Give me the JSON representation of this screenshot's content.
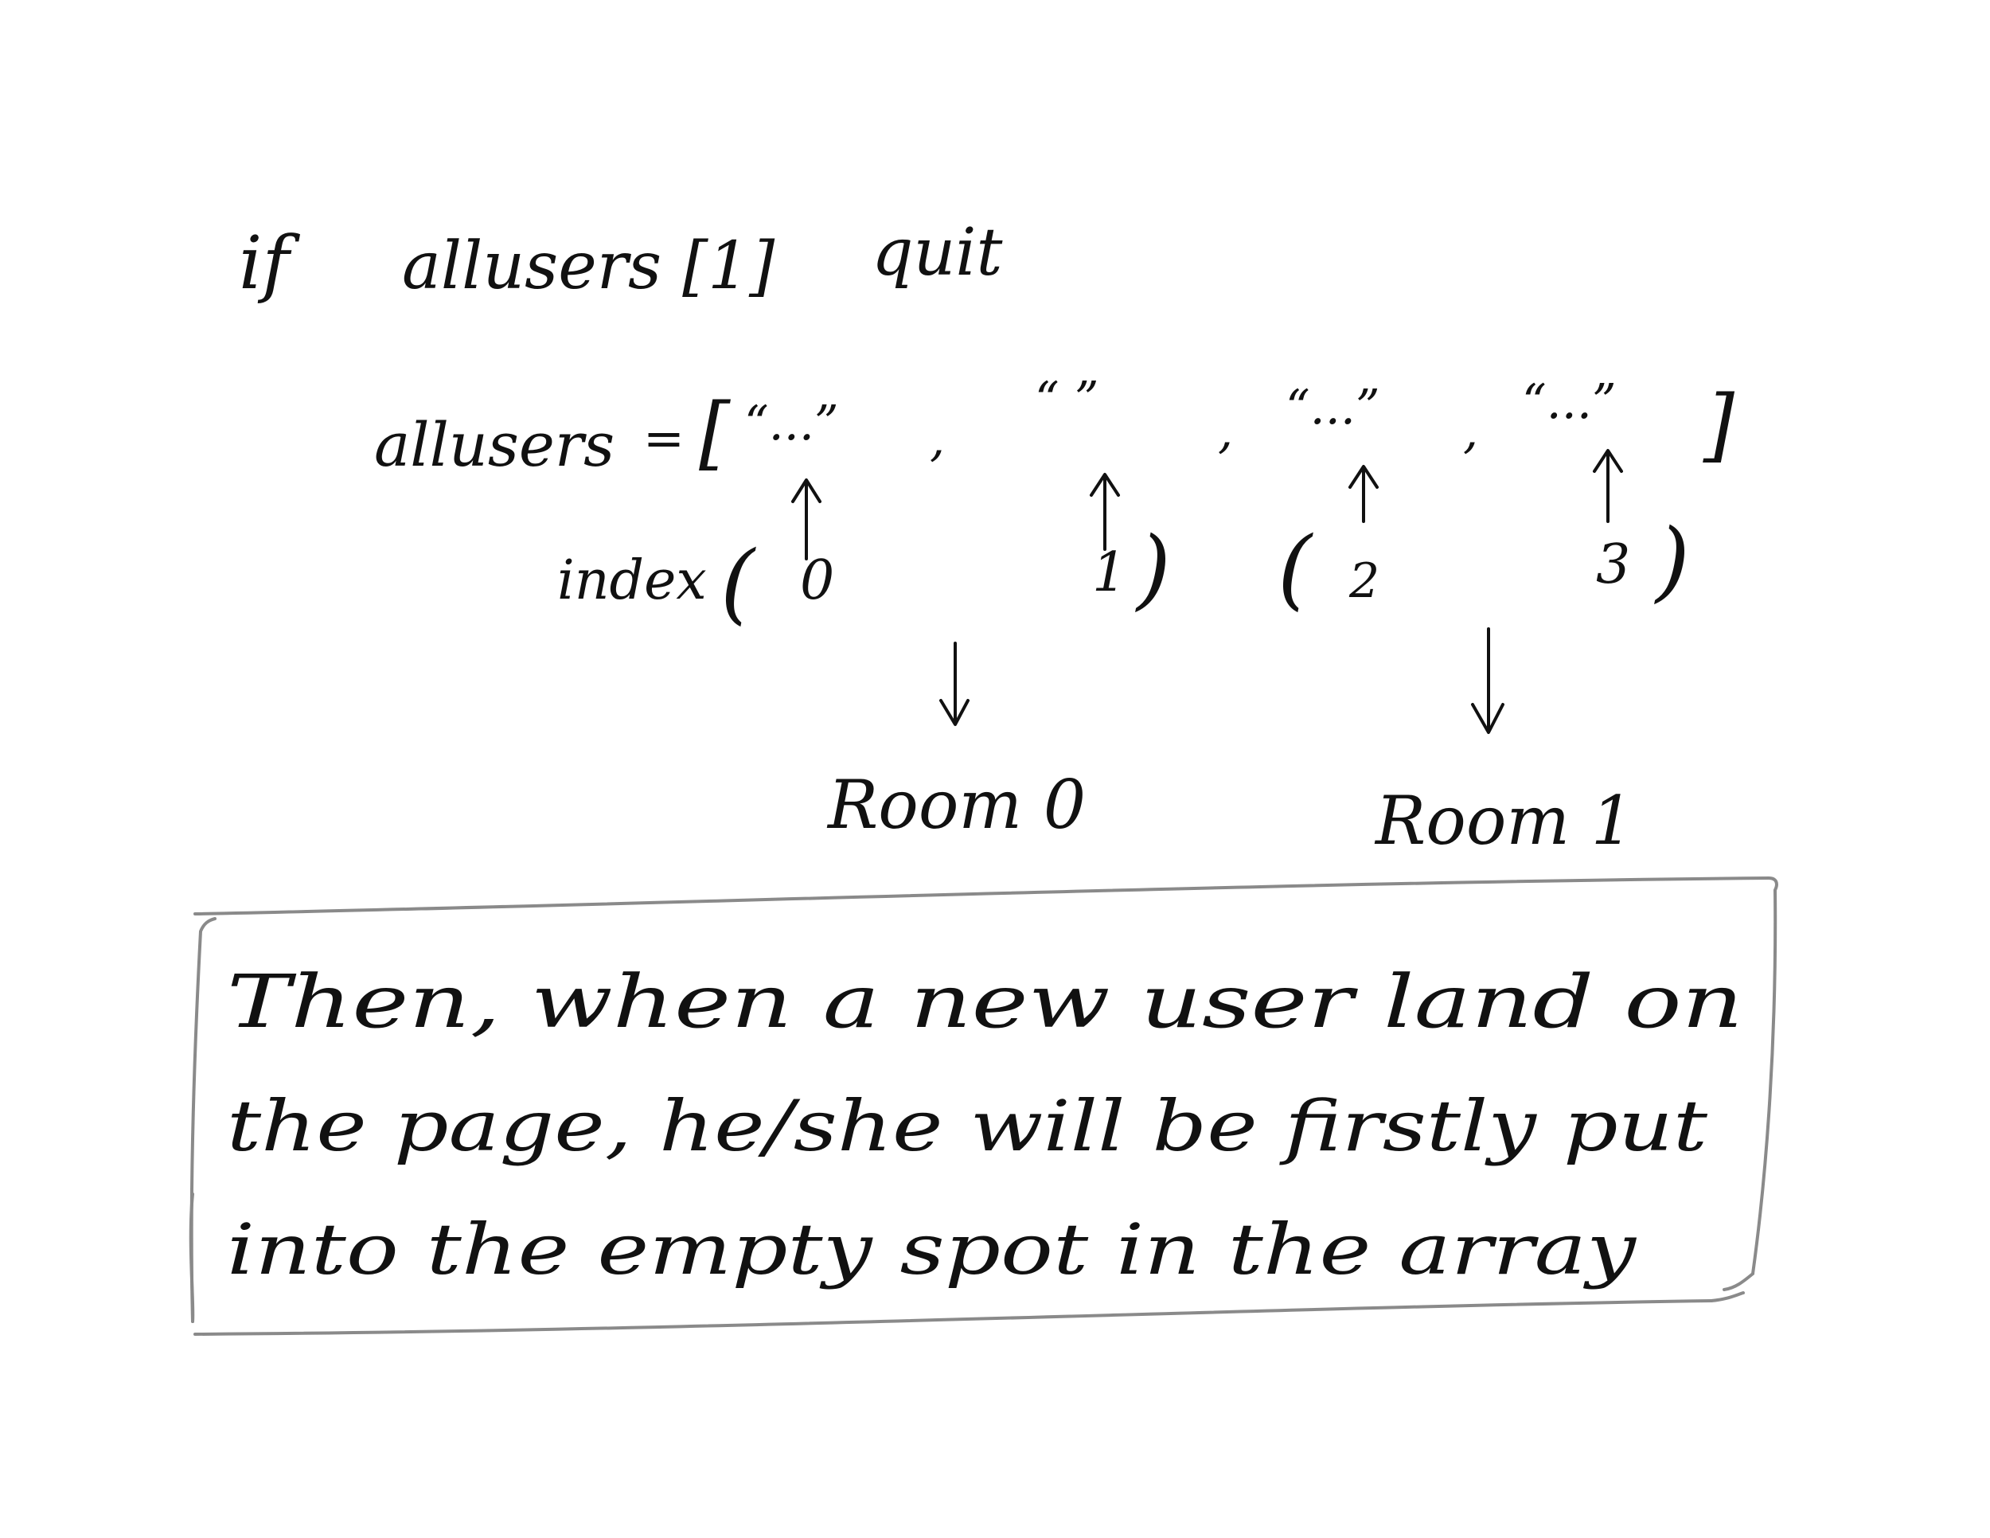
{
  "condition": {
    "keyword": "if",
    "expression": "allusers [1]",
    "action": "quit"
  },
  "array": {
    "name": "allusers",
    "assign": "=",
    "open_bracket": "[",
    "close_bracket": "]",
    "elements": [
      "“...”",
      "“  ”",
      "“...”",
      "“...”"
    ],
    "separators": [
      ",",
      ",",
      ",",
      ","
    ]
  },
  "index": {
    "label": "index",
    "open_paren_1": "(",
    "close_paren_1": ")",
    "open_paren_2": "(",
    "close_paren_2": ")",
    "values": [
      "0",
      "1",
      "2",
      "3"
    ]
  },
  "rooms": [
    "Room 0",
    "Room 1"
  ],
  "note": {
    "lines": [
      "Then, when   a   new user land on",
      "the page, he/she will be firstly put",
      "into the empty spot in the array"
    ]
  },
  "colors": {
    "ink": "#111111",
    "box": "#8a8a8a",
    "background": "#ffffff"
  }
}
